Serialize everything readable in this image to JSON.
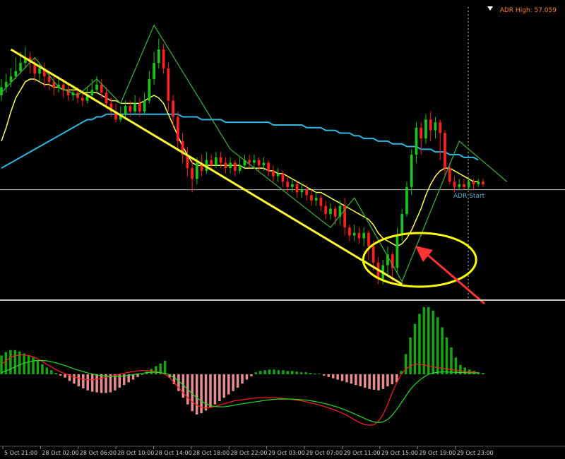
{
  "colors": {
    "background": "#000000",
    "bull_candle": "#19c519",
    "bear_candle": "#ff2020",
    "yellow_ma": "#ffff55",
    "cyan_ma": "#2fb7e0",
    "zigzag": "#3aa83a",
    "trendline": "#ffff33",
    "highlight_ellipse": "#ffff00",
    "arrow": "#ff3333",
    "macd_positive": "#15a515",
    "macd_negative": "#e68c8c",
    "signal_red": "#ff2020",
    "signal_green": "#22dd22",
    "hline": "#bcbcbc",
    "panel_divider": "#c8c8c8",
    "adr_text": "#ff7f1e",
    "adr_start_text": "#5aaad2",
    "time_axis_text": "#d0d0d0"
  },
  "labels": {
    "adr_high": "ADR High: 57.059",
    "adr_start": "ADR Start"
  },
  "icons": {
    "top_marker": "triangle-down-icon",
    "annotation_arrow": "arrow-icon",
    "annotation_ellipse": "ellipse-highlight"
  },
  "chart_data": [
    {
      "type": "candlestick",
      "title": "",
      "x_ticks": [
        "5 Oct 21:00",
        "28 Oct 02:00",
        "28 Oct 06:00",
        "28 Oct 10:00",
        "28 Oct 14:00",
        "28 Oct 18:00",
        "28 Oct 22:00",
        "29 Oct 03:00",
        "29 Oct 07:00",
        "29 Oct 11:00",
        "29 Oct 15:00",
        "29 Oct 19:00",
        "29 Oct 23:00"
      ],
      "y_range": [
        0,
        100
      ],
      "grid": false,
      "candles": [
        {
          "o": 72,
          "c": 75,
          "h": 78,
          "l": 70
        },
        {
          "o": 75,
          "c": 77,
          "h": 80,
          "l": 73
        },
        {
          "o": 77,
          "c": 79,
          "h": 82,
          "l": 75
        },
        {
          "o": 79,
          "c": 81,
          "h": 86,
          "l": 78
        },
        {
          "o": 81,
          "c": 84,
          "h": 88,
          "l": 80
        },
        {
          "o": 84,
          "c": 86,
          "h": 90,
          "l": 82
        },
        {
          "o": 86,
          "c": 84,
          "h": 88,
          "l": 80
        },
        {
          "o": 84,
          "c": 80,
          "h": 86,
          "l": 77
        },
        {
          "o": 80,
          "c": 82,
          "h": 84,
          "l": 77
        },
        {
          "o": 82,
          "c": 79,
          "h": 84,
          "l": 75
        },
        {
          "o": 79,
          "c": 77,
          "h": 81,
          "l": 74
        },
        {
          "o": 77,
          "c": 75,
          "h": 79,
          "l": 72
        },
        {
          "o": 75,
          "c": 76,
          "h": 79,
          "l": 73
        },
        {
          "o": 76,
          "c": 74,
          "h": 78,
          "l": 71
        },
        {
          "o": 74,
          "c": 72,
          "h": 76,
          "l": 70
        },
        {
          "o": 72,
          "c": 73,
          "h": 76,
          "l": 70
        },
        {
          "o": 73,
          "c": 71,
          "h": 75,
          "l": 69
        },
        {
          "o": 71,
          "c": 70,
          "h": 73,
          "l": 68
        },
        {
          "o": 70,
          "c": 72,
          "h": 75,
          "l": 69
        },
        {
          "o": 72,
          "c": 74,
          "h": 78,
          "l": 71
        },
        {
          "o": 74,
          "c": 76,
          "h": 79,
          "l": 73
        },
        {
          "o": 76,
          "c": 73,
          "h": 78,
          "l": 71
        },
        {
          "o": 73,
          "c": 69,
          "h": 75,
          "l": 67
        },
        {
          "o": 69,
          "c": 66,
          "h": 71,
          "l": 64
        },
        {
          "o": 66,
          "c": 63,
          "h": 69,
          "l": 62
        },
        {
          "o": 63,
          "c": 65,
          "h": 68,
          "l": 62
        },
        {
          "o": 65,
          "c": 68,
          "h": 70,
          "l": 63
        },
        {
          "o": 68,
          "c": 66,
          "h": 70,
          "l": 64
        },
        {
          "o": 66,
          "c": 69,
          "h": 72,
          "l": 65
        },
        {
          "o": 69,
          "c": 66,
          "h": 71,
          "l": 64
        },
        {
          "o": 66,
          "c": 70,
          "h": 73,
          "l": 65
        },
        {
          "o": 70,
          "c": 78,
          "h": 81,
          "l": 69
        },
        {
          "o": 78,
          "c": 84,
          "h": 88,
          "l": 76
        },
        {
          "o": 84,
          "c": 89,
          "h": 93,
          "l": 82
        },
        {
          "o": 89,
          "c": 82,
          "h": 91,
          "l": 80
        },
        {
          "o": 82,
          "c": 70,
          "h": 84,
          "l": 66
        },
        {
          "o": 70,
          "c": 64,
          "h": 72,
          "l": 60
        },
        {
          "o": 64,
          "c": 55,
          "h": 66,
          "l": 51
        },
        {
          "o": 55,
          "c": 50,
          "h": 58,
          "l": 47
        },
        {
          "o": 50,
          "c": 45,
          "h": 53,
          "l": 42
        },
        {
          "o": 45,
          "c": 41,
          "h": 48,
          "l": 36
        },
        {
          "o": 41,
          "c": 47,
          "h": 49,
          "l": 39
        },
        {
          "o": 47,
          "c": 44,
          "h": 50,
          "l": 42
        },
        {
          "o": 44,
          "c": 48,
          "h": 51,
          "l": 43
        },
        {
          "o": 48,
          "c": 46,
          "h": 50,
          "l": 44
        },
        {
          "o": 46,
          "c": 49,
          "h": 51,
          "l": 45
        },
        {
          "o": 49,
          "c": 47,
          "h": 51,
          "l": 45
        },
        {
          "o": 47,
          "c": 45,
          "h": 49,
          "l": 43
        },
        {
          "o": 45,
          "c": 47,
          "h": 49,
          "l": 43
        },
        {
          "o": 47,
          "c": 44,
          "h": 48,
          "l": 42
        },
        {
          "o": 44,
          "c": 46,
          "h": 49,
          "l": 43
        },
        {
          "o": 46,
          "c": 48,
          "h": 50,
          "l": 45
        },
        {
          "o": 48,
          "c": 47,
          "h": 50,
          "l": 45
        },
        {
          "o": 47,
          "c": 48,
          "h": 50,
          "l": 45
        },
        {
          "o": 48,
          "c": 46,
          "h": 49,
          "l": 44
        },
        {
          "o": 46,
          "c": 47,
          "h": 49,
          "l": 44
        },
        {
          "o": 47,
          "c": 44,
          "h": 48,
          "l": 42
        },
        {
          "o": 44,
          "c": 42,
          "h": 46,
          "l": 40
        },
        {
          "o": 42,
          "c": 43,
          "h": 45,
          "l": 40
        },
        {
          "o": 43,
          "c": 40,
          "h": 44,
          "l": 38
        },
        {
          "o": 40,
          "c": 38,
          "h": 42,
          "l": 36
        },
        {
          "o": 38,
          "c": 39,
          "h": 41,
          "l": 36
        },
        {
          "o": 39,
          "c": 36,
          "h": 40,
          "l": 34
        },
        {
          "o": 36,
          "c": 37,
          "h": 39,
          "l": 34
        },
        {
          "o": 37,
          "c": 35,
          "h": 39,
          "l": 33
        },
        {
          "o": 35,
          "c": 33,
          "h": 37,
          "l": 31
        },
        {
          "o": 33,
          "c": 34,
          "h": 36,
          "l": 31
        },
        {
          "o": 34,
          "c": 31,
          "h": 35,
          "l": 29
        },
        {
          "o": 31,
          "c": 28,
          "h": 33,
          "l": 26
        },
        {
          "o": 28,
          "c": 30,
          "h": 32,
          "l": 26
        },
        {
          "o": 30,
          "c": 27,
          "h": 31,
          "l": 24
        },
        {
          "o": 27,
          "c": 31,
          "h": 33,
          "l": 24
        },
        {
          "o": 31,
          "c": 23,
          "h": 34,
          "l": 20
        },
        {
          "o": 23,
          "c": 20,
          "h": 24,
          "l": 18
        },
        {
          "o": 20,
          "c": 21,
          "h": 24,
          "l": 18
        },
        {
          "o": 21,
          "c": 19,
          "h": 23,
          "l": 17
        },
        {
          "o": 19,
          "c": 21,
          "h": 23,
          "l": 16
        },
        {
          "o": 21,
          "c": 16,
          "h": 22,
          "l": 11
        },
        {
          "o": 16,
          "c": 10,
          "h": 18,
          "l": 7
        },
        {
          "o": 10,
          "c": 4,
          "h": 12,
          "l": 2
        },
        {
          "o": 4,
          "c": 9,
          "h": 11,
          "l": 2
        },
        {
          "o": 9,
          "c": 13,
          "h": 16,
          "l": 5
        },
        {
          "o": 13,
          "c": 8,
          "h": 14,
          "l": 3
        },
        {
          "o": 8,
          "c": 20,
          "h": 23,
          "l": 6
        },
        {
          "o": 20,
          "c": 28,
          "h": 30,
          "l": 18
        },
        {
          "o": 28,
          "c": 38,
          "h": 40,
          "l": 27
        },
        {
          "o": 38,
          "c": 50,
          "h": 52,
          "l": 35
        },
        {
          "o": 50,
          "c": 60,
          "h": 62,
          "l": 47
        },
        {
          "o": 60,
          "c": 56,
          "h": 62,
          "l": 50
        },
        {
          "o": 56,
          "c": 63,
          "h": 65,
          "l": 54
        },
        {
          "o": 63,
          "c": 59,
          "h": 66,
          "l": 55
        },
        {
          "o": 59,
          "c": 62,
          "h": 64,
          "l": 56
        },
        {
          "o": 62,
          "c": 58,
          "h": 63,
          "l": 48
        },
        {
          "o": 58,
          "c": 45,
          "h": 59,
          "l": 42
        },
        {
          "o": 45,
          "c": 40,
          "h": 47,
          "l": 39
        },
        {
          "o": 40,
          "c": 38,
          "h": 42,
          "l": 36
        },
        {
          "o": 38,
          "c": 39,
          "h": 41,
          "l": 37
        },
        {
          "o": 39,
          "c": 38,
          "h": 41,
          "l": 37
        },
        {
          "o": 38,
          "c": 40,
          "h": 41,
          "l": 37
        },
        {
          "o": 40,
          "c": 39,
          "h": 41,
          "l": 37
        },
        {
          "o": 39,
          "c": 40,
          "h": 41,
          "l": 38
        },
        {
          "o": 40,
          "c": 39,
          "h": 41,
          "l": 38
        }
      ],
      "moving_average_fast": [
        55,
        60,
        66,
        71,
        74,
        77,
        78,
        78,
        77,
        76,
        76,
        75,
        75,
        74,
        74,
        74,
        74,
        73,
        73,
        73,
        73,
        72,
        71,
        70,
        70,
        69,
        69,
        69,
        69,
        69,
        70,
        71,
        72,
        71,
        69,
        65,
        61,
        57,
        53,
        50,
        47,
        46,
        46,
        46,
        46,
        46,
        46,
        46,
        46,
        46,
        46,
        45,
        45,
        45,
        45,
        45,
        44,
        44,
        43,
        43,
        42,
        41,
        40,
        39,
        38,
        37,
        36,
        36,
        35,
        34,
        33,
        32,
        31,
        30,
        29,
        28,
        27,
        26,
        24,
        21,
        19,
        18,
        17,
        16,
        17,
        19,
        22,
        26,
        30,
        35,
        39,
        42,
        44,
        45,
        45,
        44,
        43,
        42,
        41,
        40,
        40
      ],
      "moving_average_slow": [
        45,
        46,
        47,
        48,
        49,
        50,
        51,
        52,
        53,
        54,
        55,
        56,
        57,
        58,
        59,
        60,
        61,
        62,
        63,
        63,
        64,
        64,
        65,
        65,
        65,
        65,
        65,
        65,
        65,
        65,
        65,
        65,
        65,
        65,
        65,
        65,
        65,
        65,
        64,
        64,
        64,
        64,
        63,
        63,
        63,
        63,
        63,
        62,
        62,
        62,
        62,
        62,
        62,
        62,
        62,
        62,
        62,
        61,
        61,
        61,
        61,
        61,
        61,
        61,
        60,
        60,
        60,
        60,
        59,
        59,
        59,
        58,
        58,
        58,
        57,
        57,
        56,
        56,
        56,
        55,
        55,
        55,
        54,
        54,
        54,
        53,
        53,
        53,
        52,
        52,
        52,
        51,
        51,
        51,
        50,
        50,
        50,
        49,
        49,
        49,
        48
      ],
      "hline": 37,
      "zigzag_points": [
        {
          "i": 0,
          "v": 73
        },
        {
          "i": 7,
          "v": 86
        },
        {
          "i": 12,
          "v": 75
        },
        {
          "i": 16,
          "v": 72
        },
        {
          "i": 20,
          "v": 78
        },
        {
          "i": 25,
          "v": 69
        },
        {
          "i": 32,
          "v": 98
        },
        {
          "i": 48,
          "v": 52
        },
        {
          "i": 69,
          "v": 23
        },
        {
          "i": 74,
          "v": 34
        },
        {
          "i": 84,
          "v": 3
        },
        {
          "i": 96,
          "v": 55
        },
        {
          "i": 106,
          "v": 40
        }
      ],
      "trendline": {
        "start": {
          "i": 2,
          "v": 89
        },
        "end": {
          "i": 84,
          "v": 2
        }
      },
      "adr_high": "ADR High: 57.059",
      "adr_start": "ADR Start"
    },
    {
      "type": "bar",
      "title": "",
      "y_range": [
        -1,
        1
      ],
      "histogram": [
        0.28,
        0.33,
        0.36,
        0.36,
        0.34,
        0.31,
        0.28,
        0.25,
        0.2,
        0.15,
        0.1,
        0.06,
        0.02,
        -0.02,
        -0.05,
        -0.1,
        -0.14,
        -0.18,
        -0.21,
        -0.24,
        -0.26,
        -0.27,
        -0.28,
        -0.28,
        -0.27,
        -0.24,
        -0.2,
        -0.16,
        -0.12,
        -0.08,
        -0.04,
        0.0,
        0.04,
        0.08,
        0.12,
        0.16,
        0.2,
        -0.05,
        -0.15,
        -0.25,
        -0.35,
        -0.45,
        -0.55,
        -0.6,
        -0.58,
        -0.54,
        -0.5,
        -0.45,
        -0.4,
        -0.35,
        -0.3,
        -0.25,
        -0.2,
        -0.14,
        -0.08,
        -0.03,
        0.03,
        0.05,
        0.06,
        0.07,
        0.07,
        0.06,
        0.06,
        0.05,
        0.05,
        0.04,
        0.03,
        0.03,
        0.02,
        0.01,
        0.01,
        -0.02,
        -0.04,
        -0.06,
        -0.08,
        -0.1,
        -0.12,
        -0.14,
        -0.16,
        -0.18,
        -0.2,
        -0.22,
        -0.23,
        -0.24,
        -0.22,
        -0.18,
        -0.15,
        -0.12,
        0.05,
        0.3,
        0.55,
        0.75,
        0.9,
        1.0,
        1.0,
        0.95,
        0.85,
        0.7,
        0.55,
        0.4,
        0.25,
        0.14,
        0.1,
        0.07,
        0.05,
        0.03,
        0.02
      ],
      "signal_red": [
        0.3,
        0.4,
        0.5,
        0.55,
        0.58,
        0.58,
        0.56,
        0.52,
        0.46,
        0.38,
        0.3,
        0.22,
        0.14,
        0.07,
        0.02,
        -0.03,
        -0.08,
        -0.12,
        -0.15,
        -0.16,
        -0.16,
        -0.14,
        -0.12,
        -0.09,
        -0.06,
        -0.03,
        0.0,
        0.03,
        0.06,
        0.08,
        0.1,
        0.11,
        0.11,
        0.1,
        0.08,
        0.05,
        0.0,
        -0.1,
        -0.25,
        -0.4,
        -0.55,
        -0.7,
        -0.82,
        -0.92,
        -0.98,
        -1.0,
        -0.99,
        -0.96,
        -0.92,
        -0.88,
        -0.84,
        -0.8,
        -0.78,
        -0.76,
        -0.74,
        -0.72,
        -0.71,
        -0.7,
        -0.7,
        -0.7,
        -0.7,
        -0.71,
        -0.72,
        -0.73,
        -0.75,
        -0.77,
        -0.79,
        -0.82,
        -0.85,
        -0.88,
        -0.92,
        -0.96,
        -1.0,
        -1.05,
        -1.1,
        -1.16,
        -1.22,
        -1.3,
        -1.38,
        -1.45,
        -1.5,
        -1.52,
        -1.5,
        -1.4,
        -1.2,
        -0.9,
        -0.55,
        -0.25,
        0.0,
        0.15,
        0.25,
        0.3,
        0.3,
        0.28,
        0.25,
        0.22,
        0.2,
        0.18,
        0.16,
        0.14,
        0.12,
        0.1,
        0.08,
        0.07,
        0.06,
        0.05
      ],
      "signal_green": [
        0.05,
        0.1,
        0.16,
        0.22,
        0.28,
        0.33,
        0.37,
        0.4,
        0.41,
        0.41,
        0.4,
        0.37,
        0.34,
        0.3,
        0.26,
        0.21,
        0.16,
        0.12,
        0.08,
        0.04,
        0.01,
        -0.02,
        -0.04,
        -0.05,
        -0.06,
        -0.06,
        -0.06,
        -0.05,
        -0.03,
        -0.01,
        0.01,
        0.03,
        0.05,
        0.06,
        0.06,
        0.05,
        0.03,
        -0.02,
        -0.1,
        -0.2,
        -0.32,
        -0.45,
        -0.58,
        -0.7,
        -0.8,
        -0.88,
        -0.93,
        -0.96,
        -0.97,
        -0.97,
        -0.95,
        -0.93,
        -0.9,
        -0.88,
        -0.86,
        -0.84,
        -0.82,
        -0.8,
        -0.78,
        -0.76,
        -0.75,
        -0.74,
        -0.74,
        -0.74,
        -0.74,
        -0.75,
        -0.76,
        -0.77,
        -0.79,
        -0.81,
        -0.84,
        -0.87,
        -0.9,
        -0.94,
        -0.98,
        -1.03,
        -1.08,
        -1.14,
        -1.2,
        -1.26,
        -1.32,
        -1.38,
        -1.42,
        -1.44,
        -1.42,
        -1.35,
        -1.22,
        -1.05,
        -0.85,
        -0.65,
        -0.45,
        -0.3,
        -0.18,
        -0.08,
        0.0,
        0.04,
        0.06,
        0.07,
        0.07,
        0.06,
        0.06,
        0.05,
        0.05,
        0.04,
        0.04,
        0.04
      ]
    }
  ]
}
